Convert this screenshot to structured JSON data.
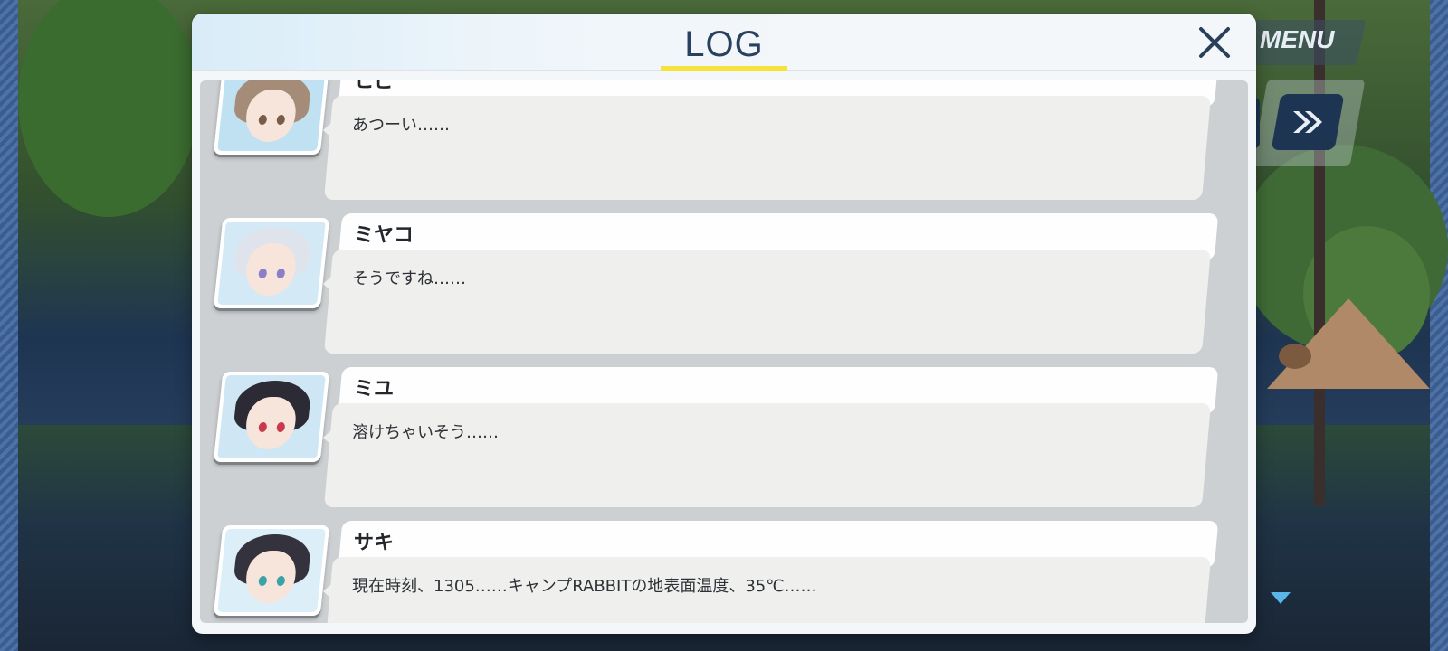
{
  "header": {
    "title": "LOG",
    "menu_label": "MENU"
  },
  "colors": {
    "title_underline": "#f5e23a",
    "title_text": "#28415f",
    "next_arrow": "#5ab6e8"
  },
  "icons": {
    "close": "close-icon",
    "fast_forward": "fast-forward-icon",
    "next": "next-arrow-icon"
  },
  "log": {
    "entries": [
      {
        "name": "ヒビ",
        "text": "あつーい……",
        "hair": "#a48c78",
        "eye": "#7a5a48",
        "bg": "#bfe1f2"
      },
      {
        "name": "ミヤコ",
        "text": "そうですね……",
        "hair": "#dfe4ec",
        "eye": "#8b7fc8",
        "bg": "#d3e9f5"
      },
      {
        "name": "ミユ",
        "text": "溶けちゃいそう……",
        "hair": "#2c2a34",
        "eye": "#c9384b",
        "bg": "#cfe7f4"
      },
      {
        "name": "サキ",
        "text": "現在時刻、1305……キャンプRABBITの地表面温度、35℃……",
        "hair": "#34323c",
        "eye": "#3aa3a8",
        "bg": "#dceef7"
      }
    ]
  }
}
